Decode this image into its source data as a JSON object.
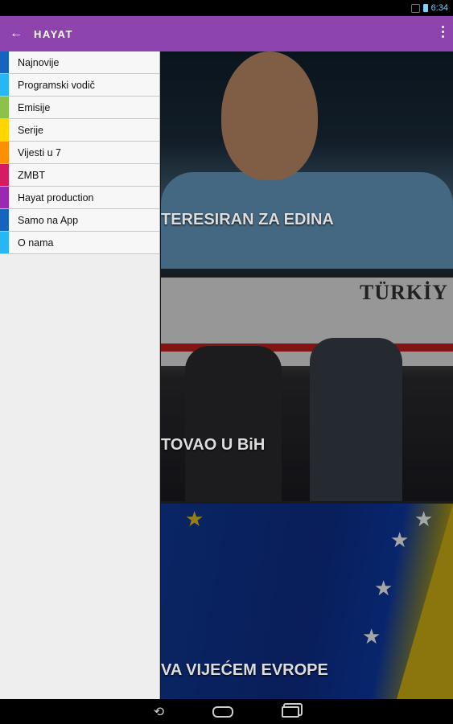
{
  "status_bar": {
    "time": "6:34"
  },
  "app_bar": {
    "back_glyph": "←",
    "title": "HAYAT",
    "overflow_icon": "more-vert-icon"
  },
  "drawer": {
    "items": [
      {
        "label": "Najnovije",
        "color": "#1565c0"
      },
      {
        "label": "Programski vodič",
        "color": "#29b6f6"
      },
      {
        "label": "Emisije",
        "color": "#8bc34a"
      },
      {
        "label": "Serije",
        "color": "#ffd600"
      },
      {
        "label": "Vijesti u 7",
        "color": "#ff8f00"
      },
      {
        "label": "ZMBT",
        "color": "#d81b60"
      },
      {
        "label": "Hayat production",
        "color": "#9c27b0"
      },
      {
        "label": "Samo na App",
        "color": "#1565c0"
      },
      {
        "label": "O nama",
        "color": "#29b6f6"
      }
    ]
  },
  "cards": [
    {
      "headline": "TERESIRAN ZA EDINA"
    },
    {
      "headline": "TOVAO U BiH",
      "plane_text": "TÜRKİY"
    },
    {
      "headline": "VA VIJEĆEM EVROPE"
    }
  ],
  "nav_bar": {
    "back_glyph": "⟲"
  },
  "colors": {
    "app_bar": "#8e44ad"
  }
}
